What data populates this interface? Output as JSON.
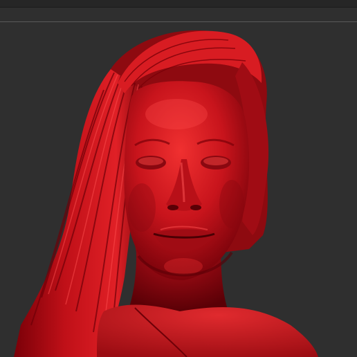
{
  "app": {
    "theme": "dark"
  },
  "viewport": {
    "subject": "sculpted-bust",
    "material_color": "#c8141c",
    "highlight_color": "#ff4a4a",
    "shadow_color": "#5a0006",
    "background_color": "#2f2f2f"
  },
  "toolbar": {
    "icon": "menu-bar"
  }
}
